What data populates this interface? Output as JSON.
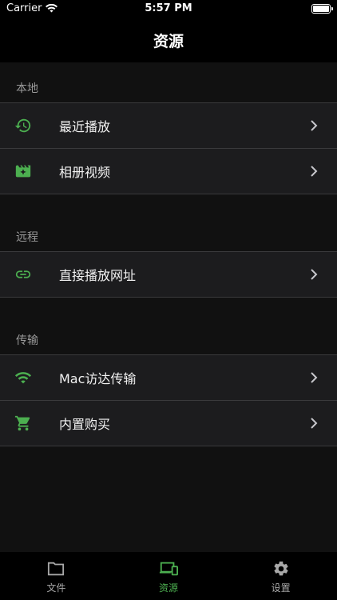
{
  "status_bar": {
    "carrier": "Carrier",
    "time": "5:57 PM"
  },
  "nav": {
    "title": "资源"
  },
  "colors": {
    "accent": "#4caf50",
    "background": "#111111",
    "row": "#1c1c1e"
  },
  "sections": [
    {
      "header": "本地",
      "items": [
        {
          "label": "最近播放",
          "icon": "history-icon"
        },
        {
          "label": "相册视频",
          "icon": "movie-icon"
        }
      ]
    },
    {
      "header": "远程",
      "items": [
        {
          "label": "直接播放网址",
          "icon": "link-icon"
        }
      ]
    },
    {
      "header": "传输",
      "items": [
        {
          "label": "Mac访达传输",
          "icon": "wifi-icon"
        },
        {
          "label": "内置购买",
          "icon": "cart-icon"
        }
      ]
    }
  ],
  "tabs": [
    {
      "label": "文件",
      "icon": "folder-icon",
      "active": false
    },
    {
      "label": "资源",
      "icon": "devices-icon",
      "active": true
    },
    {
      "label": "设置",
      "icon": "gear-icon",
      "active": false
    }
  ]
}
